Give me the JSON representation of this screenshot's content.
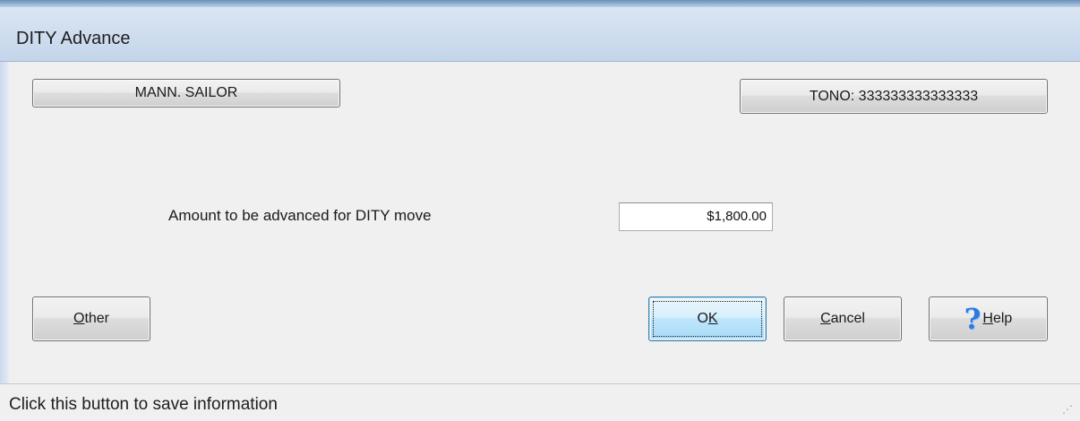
{
  "window": {
    "title": "DITY Advance"
  },
  "header_buttons": {
    "member_name": "MANN. SAILOR",
    "tono": "TONO: 333333333333333"
  },
  "form": {
    "amount_label": "Amount to be advanced for DITY move",
    "amount_value": "$1,800.00"
  },
  "buttons": {
    "other": {
      "mnemonic": "O",
      "rest": "ther"
    },
    "ok": {
      "pre": "O",
      "mnemonic": "K"
    },
    "cancel": {
      "mnemonic": "C",
      "rest": "ancel"
    },
    "help": {
      "mnemonic": "H",
      "rest": "elp",
      "icon": "help-question-icon"
    }
  },
  "statusbar": {
    "text": "Click this button to save information"
  },
  "colors": {
    "titlebar": "#cfddee",
    "default_button_border": "#3c7fb1",
    "help_icon": "#2b7be0"
  }
}
